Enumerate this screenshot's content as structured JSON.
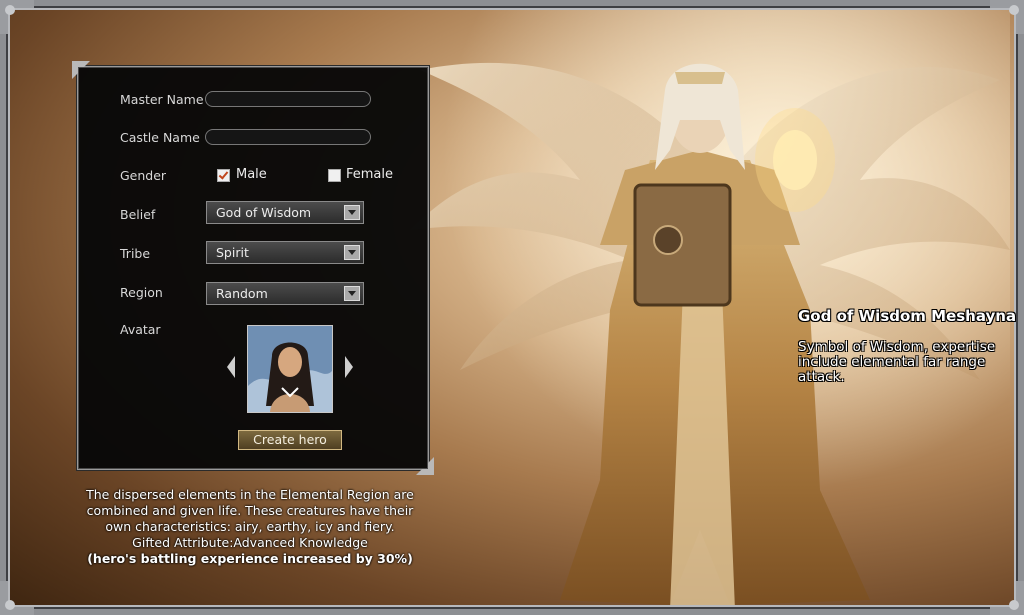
{
  "form": {
    "master_name_label": "Master Name",
    "master_name_value": "",
    "castle_name_label": "Castle Name",
    "castle_name_value": "",
    "gender_label": "Gender",
    "gender_options": [
      "Male",
      "Female"
    ],
    "gender_selected": "Male",
    "belief_label": "Belief",
    "belief_value": "God of Wisdom",
    "tribe_label": "Tribe",
    "tribe_value": "Spirit",
    "region_label": "Region",
    "region_value": "Random",
    "avatar_label": "Avatar",
    "create_button": "Create hero"
  },
  "description": {
    "lines": [
      "The dispersed elements in the Elemental Region are",
      "combined and given life. These creatures have their",
      "own characteristics: airy, earthy, icy and fiery.",
      "Gifted Attribute:Advanced Knowledge"
    ],
    "bonus": "(hero's battling experience increased by 30%)"
  },
  "god": {
    "name": "God of Wisdom Meshayna",
    "description": "Symbol of Wisdom, expertise include elemental far range attack."
  },
  "colors": {
    "panel_bg": "#080808",
    "button": "#6b5832",
    "frame": "#8d8f93",
    "check": "#c0461c"
  }
}
